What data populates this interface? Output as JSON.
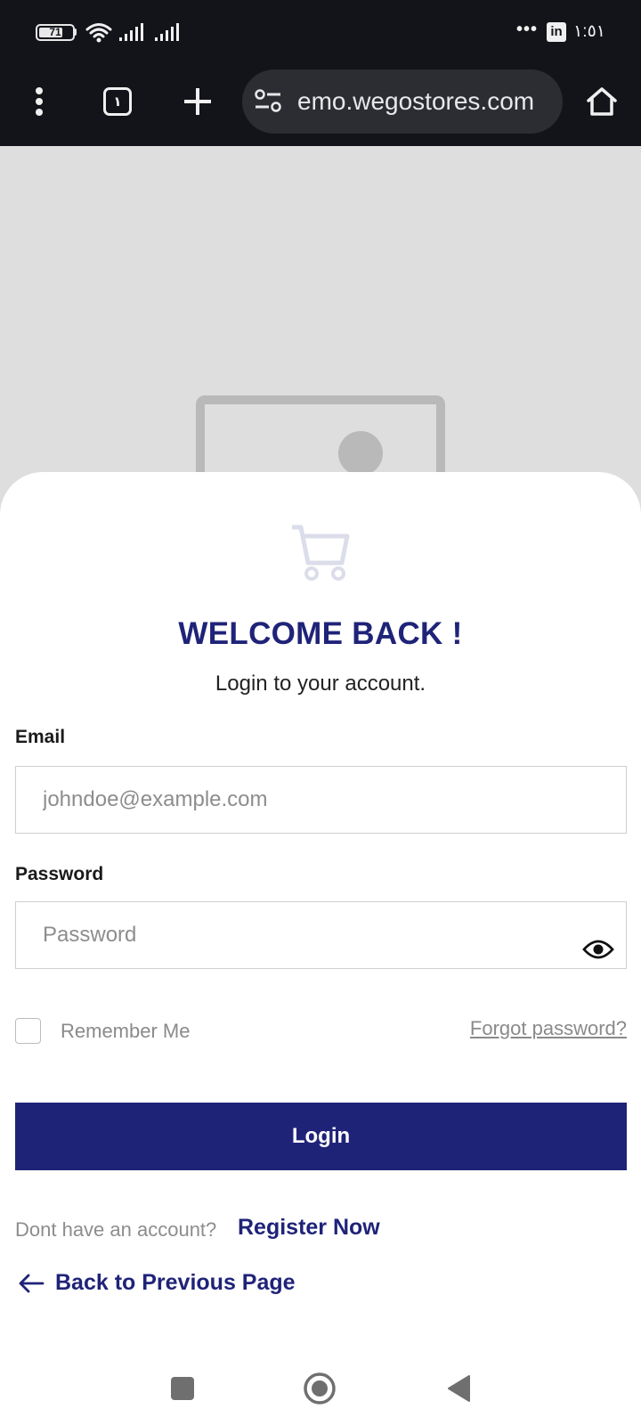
{
  "status_bar": {
    "battery_level": "71",
    "battery_fraction": 0.71,
    "time": "١:٥١",
    "overflow": "•••"
  },
  "browser": {
    "url": "emo.wegostores.com",
    "tab_count": "١",
    "icons": [
      "more-vert-icon",
      "tabs-icon",
      "new-tab-icon",
      "site-settings-icon",
      "home-icon"
    ]
  },
  "login": {
    "title": "WELCOME BACK !",
    "subtitle": "Login to your account.",
    "email_label": "Email",
    "email_placeholder": "johndoe@example.com",
    "password_label": "Password",
    "password_placeholder": "Password",
    "remember_me": "Remember Me",
    "forgot_password": "Forgot password?",
    "login_button": "Login",
    "no_account": "Dont have an account?",
    "register": "Register Now",
    "back": "Back to Previous Page"
  },
  "colors": {
    "brand": "#1f2378",
    "status_bar_bg": "#13141a",
    "hero_bg": "#dedede"
  }
}
